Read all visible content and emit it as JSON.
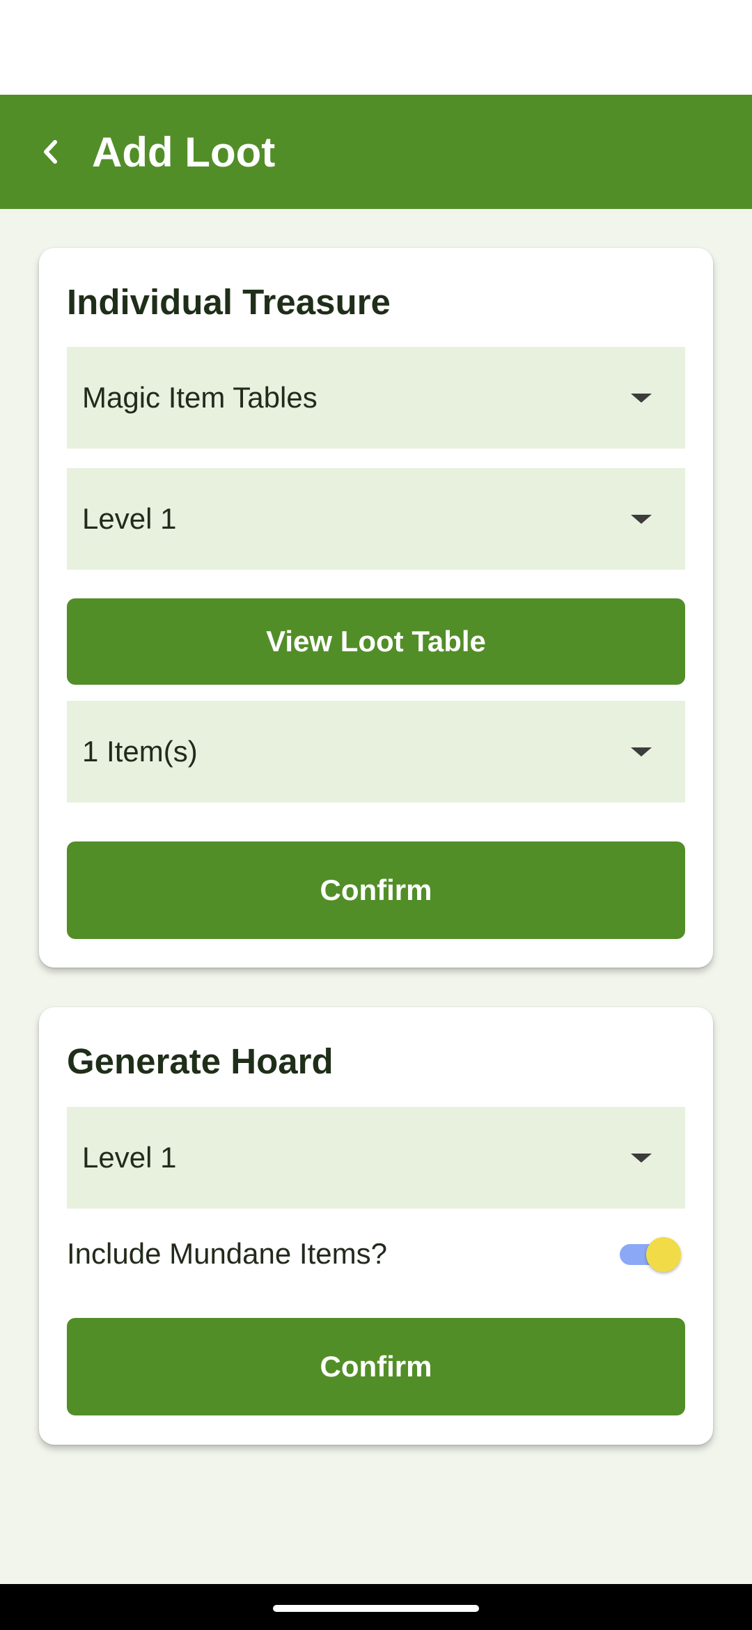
{
  "header": {
    "title": "Add Loot",
    "back_icon": "chevron-left-icon"
  },
  "individual_treasure": {
    "title": "Individual Treasure",
    "table_select": "Magic Item Tables",
    "level_select": "Level 1",
    "view_table_label": "View Loot Table",
    "count_select": "1 Item(s)",
    "confirm_label": "Confirm"
  },
  "generate_hoard": {
    "title": "Generate Hoard",
    "level_select": "Level 1",
    "mundane_label": "Include Mundane Items?",
    "mundane_enabled": true,
    "confirm_label": "Confirm"
  },
  "colors": {
    "primary": "#528e28",
    "dropdown_bg": "#e7f1de",
    "page_bg": "#f2f5ec",
    "switch_thumb": "#f1dc48",
    "switch_track": "#8aa8f6"
  }
}
